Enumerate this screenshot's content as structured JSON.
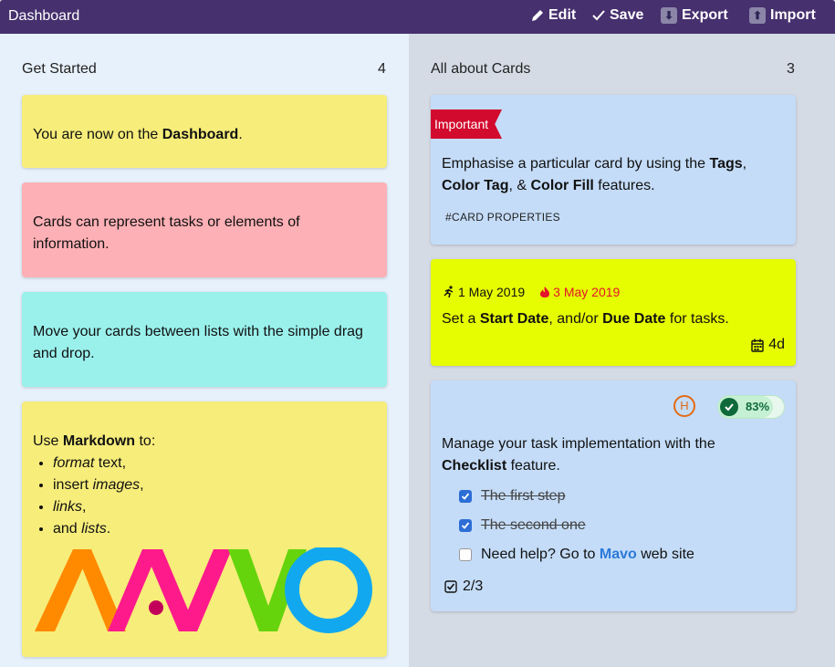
{
  "app": {
    "title": "Dashboard"
  },
  "toolbar": {
    "edit": "Edit",
    "save": "Save",
    "export": "Export",
    "import": "Import"
  },
  "lists": [
    {
      "title": "Get Started",
      "count": "4"
    },
    {
      "title": "All about Cards",
      "count": "3"
    }
  ],
  "colors": {
    "yellow": "#f7ed7a",
    "pink": "#fdb0b5",
    "cyan": "#9af1ec",
    "blue": "#c4dcf8",
    "lime": "#e6fc00",
    "topbar": "#46306e"
  },
  "cards_left": {
    "c1": {
      "pre": "You are now on the ",
      "bold": "Dashboard",
      "post": "."
    },
    "c2": {
      "text": "Cards can represent tasks or elements of information."
    },
    "c3": {
      "text": "Move your cards between lists with the simple drag and drop."
    },
    "c4": {
      "pre": "Use ",
      "bold": "Markdown",
      "post": " to:",
      "li1_em": "format",
      "li1_rest": " text,",
      "li2_pre": "insert ",
      "li2_em": "images",
      "li2_post": ",",
      "li3_em": "links",
      "li3_post": ",",
      "li4_pre": "and ",
      "li4_em": "lists",
      "li4_post": ".",
      "logo_text": "MAVO"
    }
  },
  "cards_right": {
    "c1": {
      "ribbon": "Important",
      "t1": "Emphasise a particular card by using the ",
      "b1": "Tags",
      "t2": ",",
      "b2": "Color Tag",
      "t3": ", & ",
      "b3": "Color Fill",
      "t4": " features.",
      "tag": "#CARD PROPERTIES"
    },
    "c2": {
      "start": "1 May 2019",
      "due": "3 May 2019",
      "t1": "Set a ",
      "b1": "Start Date",
      "t2": ", and/or ",
      "b2": "Due Date",
      "t3": " for tasks.",
      "duration": "4d"
    },
    "c3": {
      "avatar": "H",
      "progress_label": "83%",
      "progress": 0.83,
      "t1": "Manage your task implementation with the ",
      "b1": "Checklist",
      "t2": " feature.",
      "items": [
        {
          "text": "The first step",
          "checked": true
        },
        {
          "text": "The second one",
          "checked": true
        }
      ],
      "item3_pre": "Need help? Go to ",
      "item3_link": "Mavo",
      "item3_post": " web site",
      "count": "2/3"
    }
  }
}
